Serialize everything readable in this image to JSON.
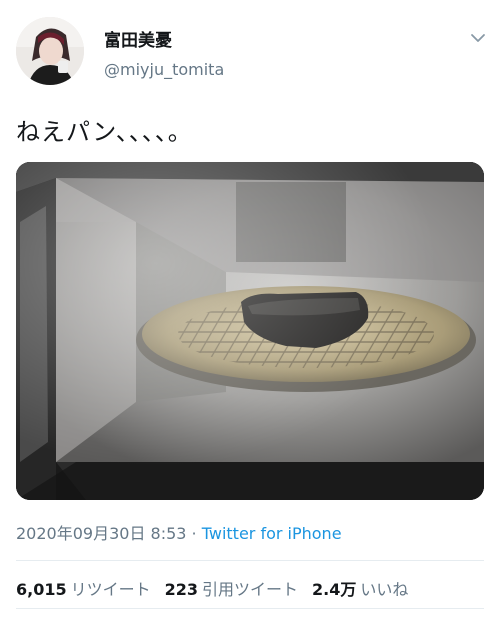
{
  "user": {
    "display_name": "富田美憂",
    "handle": "@miyju_tomita"
  },
  "tweet": {
    "text": "ねえパン、、、、。",
    "timestamp": "2020年09月30日 8:53",
    "separator": " · ",
    "source": "Twitter for iPhone"
  },
  "stats": {
    "retweets_count": "6,015",
    "retweets_label": "リツイート",
    "quotes_count": "223",
    "quotes_label": "引用ツイート",
    "likes_count": "2.4万",
    "likes_label": "いいね"
  },
  "colors": {
    "text_primary": "#14171a",
    "text_secondary": "#657786",
    "link_blue": "#1b95e0",
    "divider": "#e6ecf0"
  },
  "icons": {
    "menu": "chevron-down-icon"
  }
}
